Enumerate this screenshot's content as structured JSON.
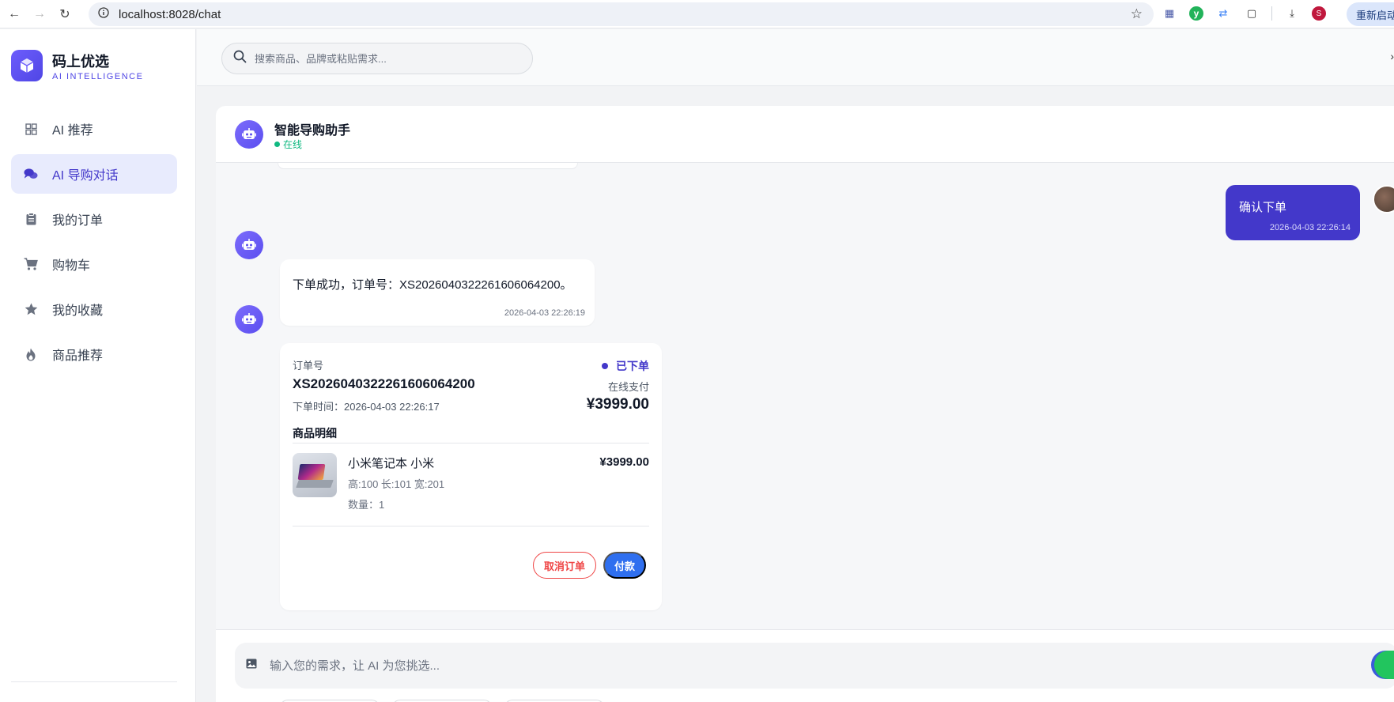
{
  "browser": {
    "url": "localhost:8028/chat",
    "restart_label": "重新启动",
    "profile_initial": "S"
  },
  "sidebar": {
    "brand_title": "码上优选",
    "brand_subtitle": "AI INTELLIGENCE",
    "items": [
      {
        "label": "AI 推荐",
        "icon": "grid-icon",
        "active": false
      },
      {
        "label": "AI 导购对话",
        "icon": "chat-bubbles-icon",
        "active": true
      },
      {
        "label": "我的订单",
        "icon": "clipboard-icon",
        "active": false
      },
      {
        "label": "购物车",
        "icon": "cart-icon",
        "active": false
      },
      {
        "label": "我的收藏",
        "icon": "star-icon",
        "active": false
      },
      {
        "label": "商品推荐",
        "icon": "flame-icon",
        "active": false
      }
    ]
  },
  "topbar": {
    "search_placeholder": "搜索商品、品牌或粘贴需求..."
  },
  "chat": {
    "assistant_name": "智能导购助手",
    "status": "在线",
    "messages": {
      "user_confirm": {
        "text": "确认下单",
        "time": "2026-04-03 22:26:14"
      },
      "bot_success": {
        "text": "下单成功，订单号：XS2026040322261606064200。",
        "time": "2026-04-03 22:26:19"
      }
    },
    "order": {
      "label": "订单号",
      "number": "XS2026040322261606064200",
      "status": "已下单",
      "payment": "在线支付",
      "time": "下单时间：2026-04-03 22:26:17",
      "total": "¥3999.00",
      "section_title": "商品明细",
      "product": {
        "name": "小米笔记本 小米",
        "price": "¥3999.00",
        "spec": "高:100 长:101 宽:201",
        "quantity": "数量：1"
      },
      "cancel_label": "取消订单",
      "pay_label": "付款"
    },
    "input_placeholder": "输入您的需求，让 AI 为您挑选..."
  },
  "colors": {
    "accent": "#4338ca",
    "pay_button": "#2f6fef",
    "cancel": "#ef4444",
    "online": "#10b981"
  }
}
